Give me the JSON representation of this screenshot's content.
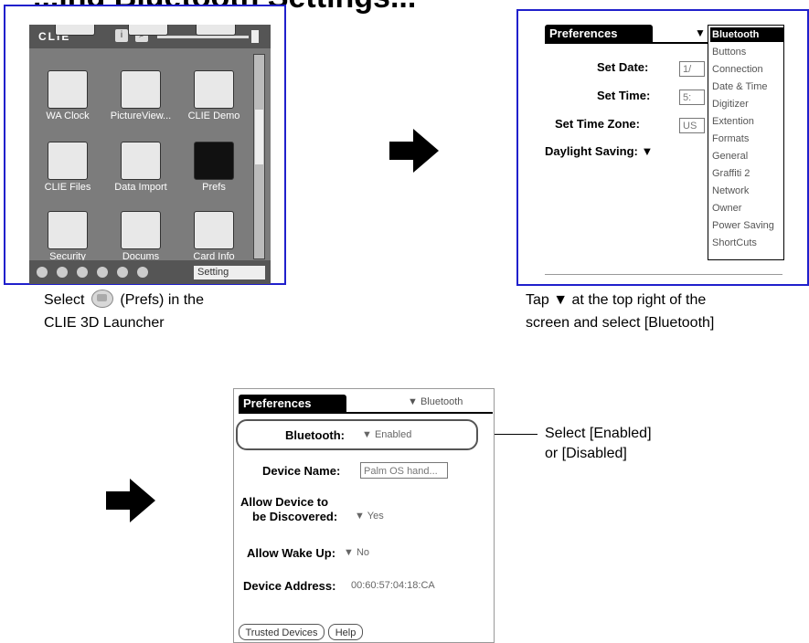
{
  "page": {
    "heading": "...ing Bluetooth Settings..."
  },
  "screen1": {
    "brand": "CLIE",
    "apps": [
      {
        "label": "WA Clock"
      },
      {
        "label": "PictureView..."
      },
      {
        "label": "CLIE Demo"
      },
      {
        "label": "CLIE Files"
      },
      {
        "label": "Data Import"
      },
      {
        "label": "Prefs"
      },
      {
        "label": "Security"
      },
      {
        "label": "Docums"
      },
      {
        "label": "Card Info"
      }
    ],
    "category": "Setting",
    "caption_before": "Select",
    "caption_after": "(Prefs) in the",
    "caption_line2": "CLIE 3D Launcher"
  },
  "screen2": {
    "title": "Preferences",
    "trigger_arrow": "▼",
    "labels": {
      "set_date": "Set Date:",
      "set_time": "Set Time:",
      "set_time_zone": "Set Time Zone:",
      "daylight_saving": "Daylight Saving: ▼"
    },
    "field_values": {
      "date": "1/",
      "time": "5:",
      "zone": "US"
    },
    "menu_items": [
      "Bluetooth",
      "Buttons",
      "Connection",
      "Date & Time",
      "Digitizer",
      "Extention",
      "Formats",
      "General",
      "Graffiti 2",
      "Network",
      "Owner",
      "Power Saving",
      "ShortCuts"
    ],
    "caption_line1": "Tap ▼ at the top right of the",
    "caption_line2": "screen and select [Bluetooth]"
  },
  "screen3": {
    "title": "Preferences",
    "panel": "▼ Bluetooth",
    "bluetooth_label": "Bluetooth:",
    "bluetooth_value": "▼ Enabled",
    "device_name_label": "Device Name:",
    "device_name_value": "Palm OS hand...",
    "discover_label_1": "Allow Device to",
    "discover_label_2": "be Discovered:",
    "discover_value": "▼ Yes",
    "wake_label": "Allow Wake Up:",
    "wake_value": "▼ No",
    "address_label": "Device Address:",
    "address_value": "00:60:57:04:18:CA",
    "trusted_button": "Trusted Devices",
    "help_button": "Help",
    "callout_line1": "Select [Enabled]",
    "callout_line2": "or [Disabled]"
  }
}
